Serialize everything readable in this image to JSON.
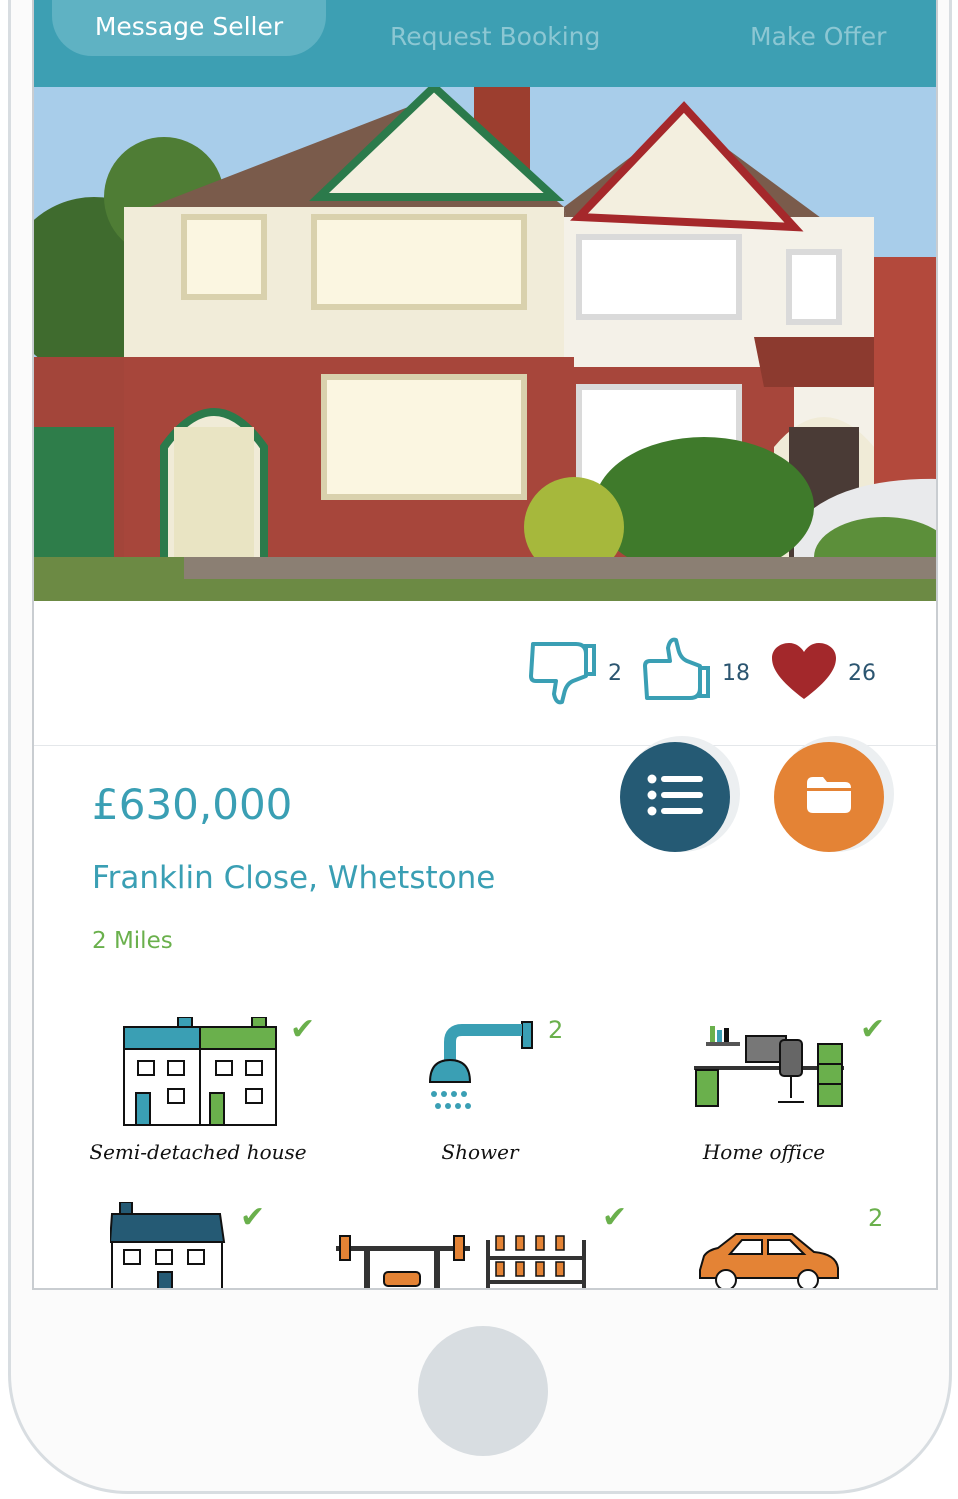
{
  "tabs": [
    {
      "label": "Message Seller",
      "active": true
    },
    {
      "label": "Request Booking",
      "active": false
    },
    {
      "label": "Make Offer",
      "active": false
    }
  ],
  "reactions": {
    "dislikes": "2",
    "likes": "18",
    "favourites": "26"
  },
  "listing": {
    "price": "£630,000",
    "address": "Franklin Close, Whetstone",
    "distance": "2 Miles"
  },
  "features": [
    {
      "label": "Semi-detached house",
      "badge": "check"
    },
    {
      "label": "Shower",
      "badge": "2"
    },
    {
      "label": "Home office",
      "badge": "check"
    },
    {
      "label": "",
      "badge": "check"
    },
    {
      "label": "",
      "badge": "check"
    },
    {
      "label": "",
      "badge": "2"
    }
  ],
  "colors": {
    "brand": "#3d9fb3",
    "accent_orange": "#e48335",
    "accent_navy": "#255a74",
    "check_green": "#6ab04c",
    "heart_red": "#a3282b"
  },
  "icons": [
    "thumbs-down-icon",
    "thumbs-up-icon",
    "heart-icon",
    "list-icon",
    "folder-icon"
  ]
}
